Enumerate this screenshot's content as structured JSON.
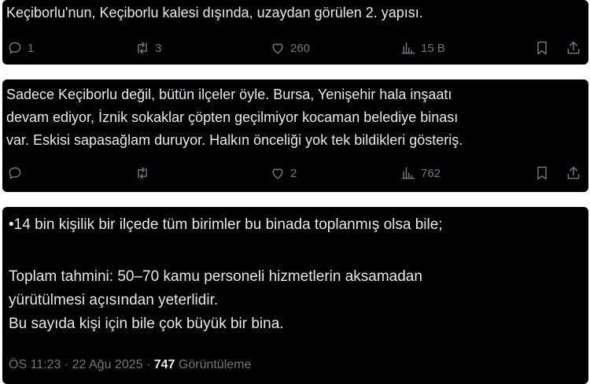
{
  "tweets": [
    {
      "text": "Keçiborlu'nun, Keçiborlu kalesi dışında, uzaydan görülen 2. yapısı.",
      "replies": "1",
      "reposts": "3",
      "likes": "260",
      "views": "15 B"
    },
    {
      "text": "Sadece Keçiborlu değil, bütün ilçeler öyle. Bursa, Yenişehir hala inşaatı\ndevam ediyor, İznik sokaklar çöpten geçilmiyor kocaman belediye binası\nvar. Eskisi sapasağlam duruyor. Halkın önceliği yok tek bildikleri gösteriş.",
      "replies": "",
      "reposts": "",
      "likes": "2",
      "views": "762"
    }
  ],
  "main_tweet": {
    "line1": "•14 bin kişilik bir ilçede tüm birimler bu binada toplanmış olsa bile;",
    "body": "Toplam tahmini: 50–70 kamu personeli hizmetlerin aksamadan\nyürütülmesi açısından yeterlidir.\nBu sayıda kişi için bile çok büyük bir bina.",
    "time": "ÖS 11:23",
    "date": "22 Ağu 2025",
    "views_count": "747",
    "views_label": "Görüntüleme"
  },
  "colors": {
    "background": "#000000",
    "text": "#e7e9ea",
    "muted": "#71767b"
  },
  "icons": [
    "reply-icon",
    "repost-icon",
    "like-icon",
    "views-icon",
    "bookmark-icon",
    "share-icon"
  ]
}
